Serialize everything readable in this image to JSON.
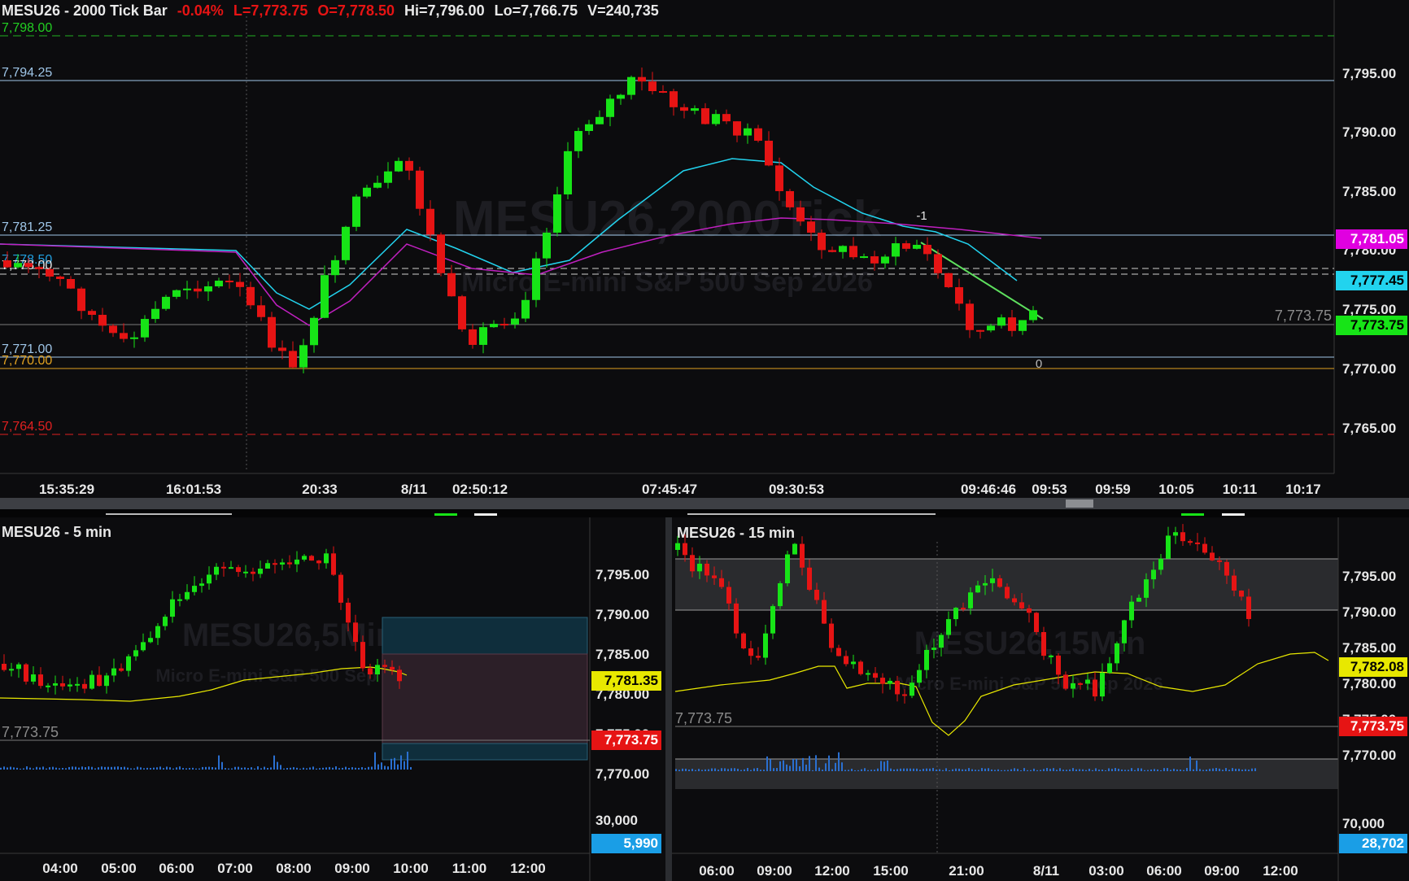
{
  "header": {
    "symbol_title": "MESU26 - 2000 Tick Bar",
    "change": "-0.04%",
    "last": "L=7,773.75",
    "open": "O=7,778.50",
    "high": "Hi=7,796.00",
    "low": "Lo=7,766.75",
    "volume": "V=240,735"
  },
  "colors": {
    "up": "#17e417",
    "down": "#e61414",
    "background": "#0c0c0e",
    "grid": "#4a4a4a",
    "accent_magenta": "#e000e0",
    "accent_cyan": "#22d3ee",
    "accent_yellow": "#e8e800",
    "level_green": "#22b022",
    "level_red": "#e02020",
    "level_orange": "#e0a020"
  },
  "main_chart": {
    "watermark": "MESU26,2000Tick",
    "watermark_sub": "Micro E-mini S&P 500 Sep 2026",
    "level_labels": {
      "l7798": "7,798.00",
      "l7794": "7,794.25",
      "l7781": "7,781.25",
      "l7778a": "7,778.50",
      "l7778b": "7,778.00",
      "l7771": "7,771.00",
      "l7770": "7,770.00",
      "l7764": "7,764.50"
    },
    "price_axis": [
      "7,795.00",
      "7,790.00",
      "7,785.00",
      "7,780.00",
      "7,775.00",
      "7,770.00",
      "7,765.00"
    ],
    "axis_tags": {
      "magenta": "7,781.05",
      "cyan": "7,777.45",
      "last": "7,773.75",
      "last_ghost": "7,773.75"
    },
    "annotations": {
      "minus_one": "-1",
      "zero": "0"
    },
    "time_axis": [
      "15:35:29",
      "16:01:53",
      "20:33",
      "8/11",
      "02:50:12",
      "07:45:47",
      "09:30:53",
      "09:46:46",
      "09:53",
      "09:59",
      "10:05",
      "10:11",
      "10:17"
    ]
  },
  "chart_5min": {
    "title": "MESU26 - 5 min",
    "watermark": "MESU26,5Min",
    "watermark_sub": "Micro E-mini S&P 500 Sep 2026",
    "price_axis": [
      "7,795.00",
      "7,790.00",
      "7,785.00",
      "7,780.00",
      "7,775.00",
      "7,770.00"
    ],
    "volume_axis": "30,000",
    "tags": {
      "yellow": "7,781.35",
      "last": "7,773.75",
      "volume": "5,990"
    },
    "last_ghost": "7,773.75",
    "time_axis": [
      "04:00",
      "05:00",
      "06:00",
      "07:00",
      "08:00",
      "09:00",
      "10:00",
      "11:00",
      "12:00"
    ]
  },
  "chart_15min": {
    "title": "MESU26 - 15 min",
    "watermark": "MESU26,15Min",
    "watermark_sub": "Micro E-mini S&P 500 Sep 2026",
    "price_axis": [
      "7,795.00",
      "7,790.00",
      "7,785.00",
      "7,780.00",
      "7,775.00",
      "7,770.00"
    ],
    "volume_axis": "70,000",
    "tags": {
      "yellow": "7,782.08",
      "last": "7,773.75",
      "volume": "28,702"
    },
    "last_ghost": "7,773.75",
    "time_axis": [
      "06:00",
      "09:00",
      "12:00",
      "15:00",
      "21:00",
      "8/11",
      "03:00",
      "06:00",
      "09:00",
      "12:00"
    ]
  }
}
